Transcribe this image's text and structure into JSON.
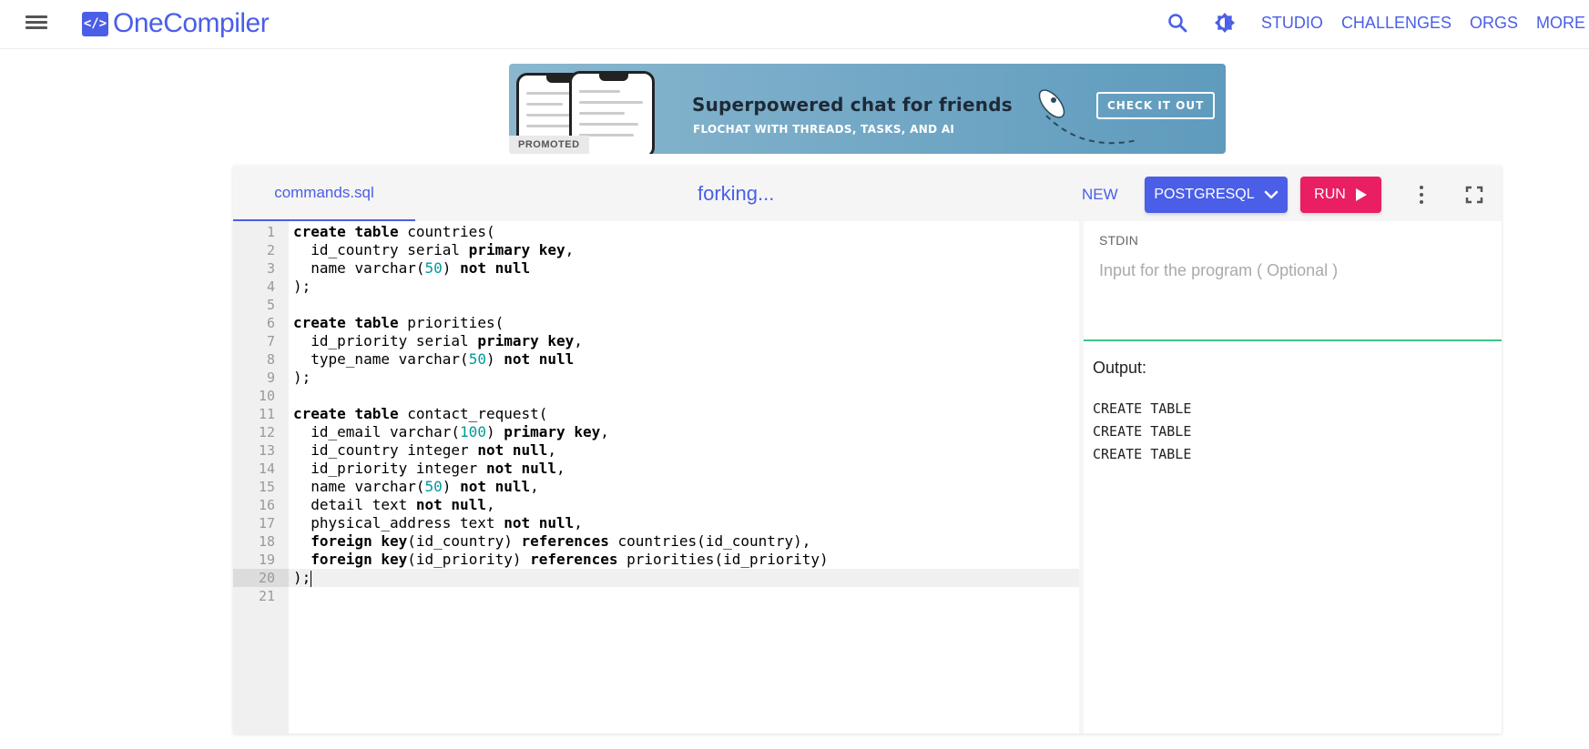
{
  "brand": {
    "name": "OneCompiler",
    "logo_glyph": "</>",
    "color": "#4a5ee8"
  },
  "nav": {
    "links": [
      "STUDIO",
      "CHALLENGES",
      "ORGS",
      "MORE"
    ],
    "search_icon": "search-icon",
    "theme_icon": "theme-toggle-icon"
  },
  "banner": {
    "title": "Superpowered chat for friends",
    "subtitle": "FLOCHAT WITH THREADS, TASKS, AND AI",
    "cta": "CHECK IT OUT",
    "promoted": "PROMOTED"
  },
  "editor": {
    "file_tab": "commands.sql",
    "status": "forking...",
    "new_label": "NEW",
    "language": "POSTGRESQL",
    "run_label": "RUN",
    "active_line": 20,
    "lines": [
      "create table countries(",
      "  id_country serial primary key,",
      "  name varchar(50) not null",
      ");",
      "",
      "create table priorities(",
      "  id_priority serial primary key,",
      "  type_name varchar(50) not null",
      ");",
      "",
      "create table contact_request(",
      "  id_email varchar(100) primary key,",
      "  id_country integer not null,",
      "  id_priority integer not null,",
      "  name varchar(50) not null,",
      "  detail text not null,",
      "  physical_address text not null,",
      "  foreign key(id_country) references countries(id_country),",
      "  foreign key(id_priority) references priorities(id_priority)",
      ");",
      ""
    ]
  },
  "stdin": {
    "label": "STDIN",
    "placeholder": "Input for the program ( Optional )",
    "value": ""
  },
  "output": {
    "label": "Output:",
    "lines": [
      "CREATE TABLE",
      "CREATE TABLE",
      "CREATE TABLE"
    ]
  },
  "colors": {
    "accent": "#4a5ee8",
    "run": "#e91e63",
    "divider": "#3cc48a",
    "number": "#009999"
  }
}
